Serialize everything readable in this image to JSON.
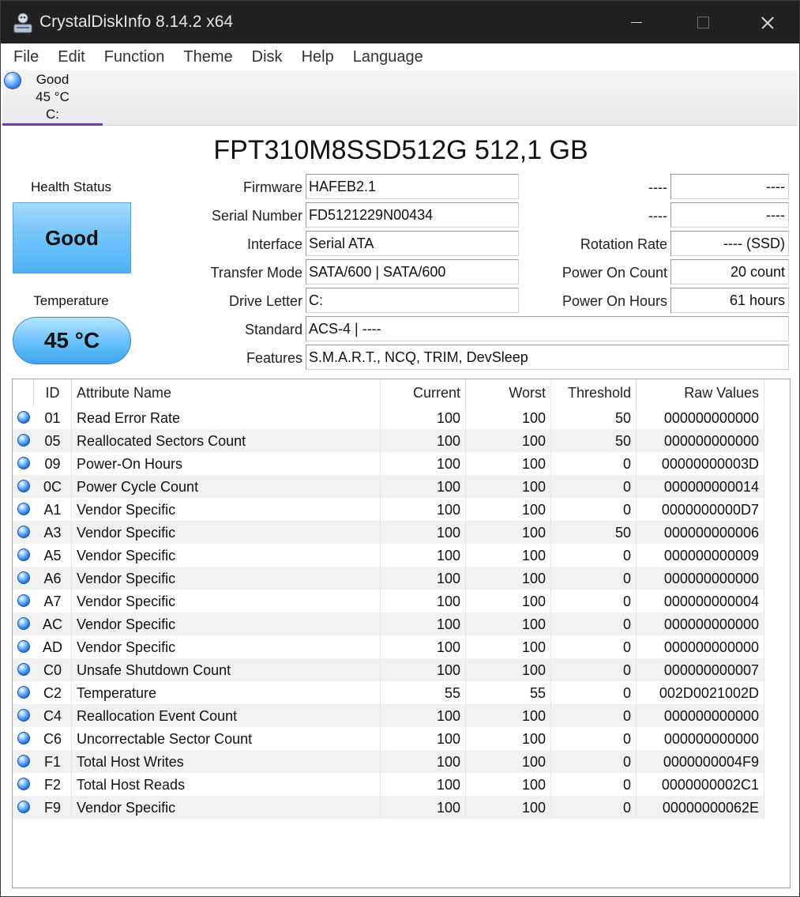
{
  "window": {
    "title": "CrystalDiskInfo 8.14.2 x64"
  },
  "menu": [
    "File",
    "Edit",
    "Function",
    "Theme",
    "Disk",
    "Help",
    "Language"
  ],
  "drive_tab": {
    "status": "Good",
    "temp": "45 °C",
    "letter": "C:"
  },
  "model": "FPT310M8SSD512G 512,1 GB",
  "health": {
    "label": "Health Status",
    "value": "Good"
  },
  "temperature": {
    "label": "Temperature",
    "value": "45 °C"
  },
  "info": {
    "firmware": {
      "label": "Firmware",
      "value": "HAFEB2.1"
    },
    "serial": {
      "label": "Serial Number",
      "value": "FD5121229N00434"
    },
    "interface": {
      "label": "Interface",
      "value": "Serial ATA"
    },
    "transfer": {
      "label": "Transfer Mode",
      "value": "SATA/600 | SATA/600"
    },
    "drive_letter": {
      "label": "Drive Letter",
      "value": "C:"
    },
    "standard": {
      "label": "Standard",
      "value": "ACS-4 | ----"
    },
    "features": {
      "label": "Features",
      "value": "S.M.A.R.T., NCQ, TRIM, DevSleep"
    }
  },
  "right_info": {
    "r1": {
      "label": "----",
      "value": "----"
    },
    "r2": {
      "label": "----",
      "value": "----"
    },
    "rotation": {
      "label": "Rotation Rate",
      "value": "---- (SSD)"
    },
    "power_count": {
      "label": "Power On Count",
      "value": "20 count"
    },
    "power_hours": {
      "label": "Power On Hours",
      "value": "61 hours"
    }
  },
  "smart_headers": {
    "id": "ID",
    "name": "Attribute Name",
    "current": "Current",
    "worst": "Worst",
    "threshold": "Threshold",
    "raw": "Raw Values"
  },
  "smart_rows": [
    {
      "id": "01",
      "name": "Read Error Rate",
      "current": "100",
      "worst": "100",
      "threshold": "50",
      "raw": "000000000000"
    },
    {
      "id": "05",
      "name": "Reallocated Sectors Count",
      "current": "100",
      "worst": "100",
      "threshold": "50",
      "raw": "000000000000"
    },
    {
      "id": "09",
      "name": "Power-On Hours",
      "current": "100",
      "worst": "100",
      "threshold": "0",
      "raw": "00000000003D"
    },
    {
      "id": "0C",
      "name": "Power Cycle Count",
      "current": "100",
      "worst": "100",
      "threshold": "0",
      "raw": "000000000014"
    },
    {
      "id": "A1",
      "name": "Vendor Specific",
      "current": "100",
      "worst": "100",
      "threshold": "0",
      "raw": "0000000000D7"
    },
    {
      "id": "A3",
      "name": "Vendor Specific",
      "current": "100",
      "worst": "100",
      "threshold": "50",
      "raw": "000000000006"
    },
    {
      "id": "A5",
      "name": "Vendor Specific",
      "current": "100",
      "worst": "100",
      "threshold": "0",
      "raw": "000000000009"
    },
    {
      "id": "A6",
      "name": "Vendor Specific",
      "current": "100",
      "worst": "100",
      "threshold": "0",
      "raw": "000000000000"
    },
    {
      "id": "A7",
      "name": "Vendor Specific",
      "current": "100",
      "worst": "100",
      "threshold": "0",
      "raw": "000000000004"
    },
    {
      "id": "AC",
      "name": "Vendor Specific",
      "current": "100",
      "worst": "100",
      "threshold": "0",
      "raw": "000000000000"
    },
    {
      "id": "AD",
      "name": "Vendor Specific",
      "current": "100",
      "worst": "100",
      "threshold": "0",
      "raw": "000000000000"
    },
    {
      "id": "C0",
      "name": "Unsafe Shutdown Count",
      "current": "100",
      "worst": "100",
      "threshold": "0",
      "raw": "000000000007"
    },
    {
      "id": "C2",
      "name": "Temperature",
      "current": "55",
      "worst": "55",
      "threshold": "0",
      "raw": "002D0021002D"
    },
    {
      "id": "C4",
      "name": "Reallocation Event Count",
      "current": "100",
      "worst": "100",
      "threshold": "0",
      "raw": "000000000000"
    },
    {
      "id": "C6",
      "name": "Uncorrectable Sector Count",
      "current": "100",
      "worst": "100",
      "threshold": "0",
      "raw": "000000000000"
    },
    {
      "id": "F1",
      "name": "Total Host Writes",
      "current": "100",
      "worst": "100",
      "threshold": "0",
      "raw": "0000000004F9"
    },
    {
      "id": "F2",
      "name": "Total Host Reads",
      "current": "100",
      "worst": "100",
      "threshold": "0",
      "raw": "0000000002C1"
    },
    {
      "id": "F9",
      "name": "Vendor Specific",
      "current": "100",
      "worst": "100",
      "threshold": "0",
      "raw": "00000000062E"
    }
  ],
  "icons": {
    "app": "crystaldiskinfo-app-icon",
    "status_dot": "status-good-dot-icon"
  },
  "colors": {
    "accent_tab": "#6b3fa8",
    "good_blue": "#4fb2f5"
  }
}
